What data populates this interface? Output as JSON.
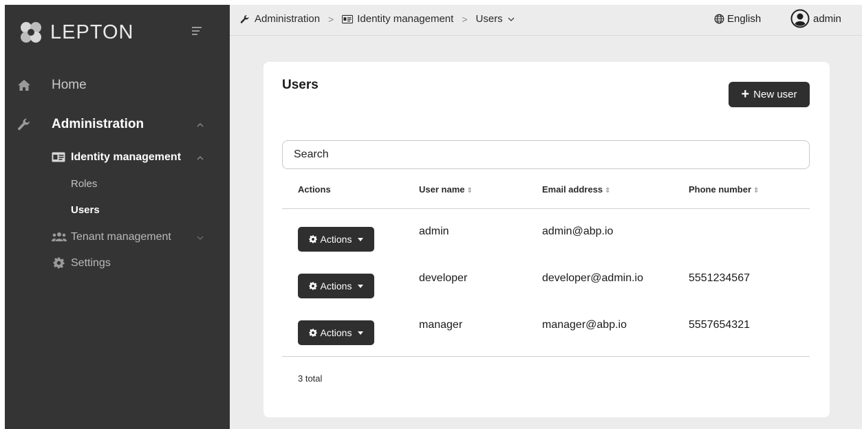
{
  "sidebar": {
    "brand": "LEPTON",
    "items": {
      "home": "Home",
      "administration": "Administration",
      "identity_management": "Identity management",
      "roles": "Roles",
      "users": "Users",
      "tenant_management": "Tenant management",
      "settings": "Settings"
    }
  },
  "topbar": {
    "breadcrumb": [
      "Administration",
      "Identity management",
      "Users"
    ],
    "language": "English",
    "user": "admin"
  },
  "card": {
    "title": "Users",
    "new_user_label": "New user",
    "search_placeholder": "Search",
    "columns": [
      "Actions",
      "User name",
      "Email address",
      "Phone number"
    ],
    "rows": [
      {
        "action_label": "Actions",
        "username": "admin",
        "email": "admin@abp.io",
        "phone": ""
      },
      {
        "action_label": "Actions",
        "username": "developer",
        "email": "developer@admin.io",
        "phone": "5551234567"
      },
      {
        "action_label": "Actions",
        "username": "manager",
        "email": "manager@abp.io",
        "phone": "5557654321"
      }
    ],
    "total": "3 total"
  },
  "colors": {
    "sidebar_bg": "#343434",
    "main_bg": "#ececec",
    "button_bg": "#2f2f2f"
  },
  "icons": {
    "home": "home-icon",
    "administration": "wrench-icon",
    "identity_management": "id-card-icon",
    "tenant_management": "users-group-icon",
    "settings": "gear-icon",
    "language": "globe-icon",
    "user": "user-circle-icon",
    "brand": "lepton-logo-icon"
  }
}
